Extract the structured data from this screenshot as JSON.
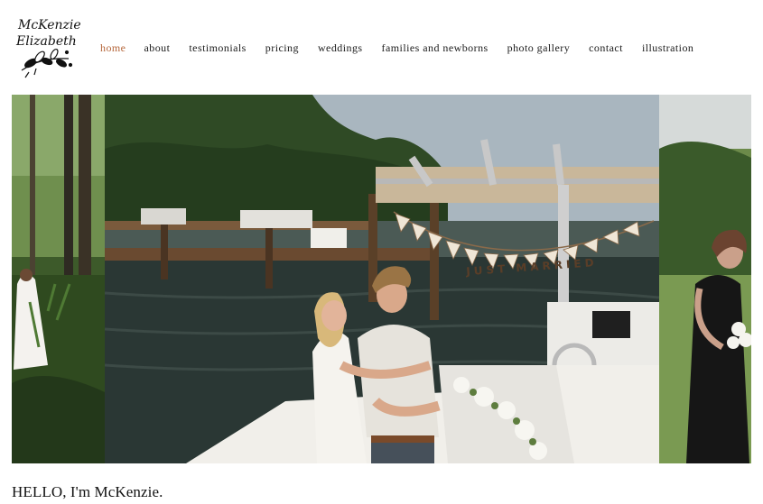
{
  "logo": {
    "line1": "McKenzie",
    "line2": "Elizabeth"
  },
  "nav": {
    "items": [
      {
        "label": "home",
        "active": true
      },
      {
        "label": "about",
        "active": false
      },
      {
        "label": "testimonials",
        "active": false
      },
      {
        "label": "pricing",
        "active": false
      },
      {
        "label": "weddings",
        "active": false
      },
      {
        "label": "families and newborns",
        "active": false
      },
      {
        "label": "photo gallery",
        "active": false
      },
      {
        "label": "contact",
        "active": false
      },
      {
        "label": "illustration",
        "active": false
      }
    ]
  },
  "gallery": {
    "banner_text": "JUST MARRIED"
  },
  "intro": {
    "heading": "HELLO, I'm McKenzie."
  },
  "colors": {
    "accent": "#b5663a",
    "text": "#1b1b1b"
  }
}
